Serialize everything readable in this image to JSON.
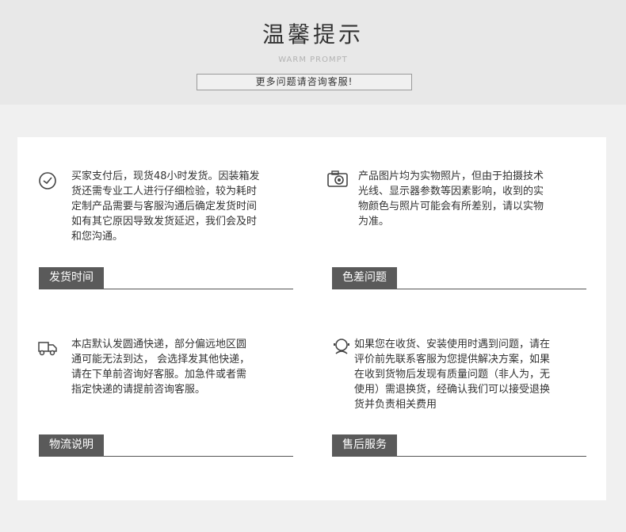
{
  "header": {
    "title": "温馨提示",
    "subtitle": "WARM PROMPT",
    "tip": "更多问题请咨询客服!"
  },
  "sections": [
    {
      "label": "发货时间",
      "icon": "clock-icon",
      "lines": [
        "买家支付后，现货48小时发货。因装箱发",
        "货还需专业工人进行仔细检验，较为耗时",
        "定制产品需要与客服沟通后确定发货时间",
        "如有其它原因导致发货延迟，我们会及时",
        "和您沟通。"
      ]
    },
    {
      "label": "色差问题",
      "icon": "camera-icon",
      "lines": [
        "产品图片均为实物照片，但由于拍摄技术",
        "光线、显示器参数等因素影响，收到的实",
        "物颜色与照片可能会有所差别，请以实物",
        "为准。"
      ]
    },
    {
      "label": "物流说明",
      "icon": "delivery-truck-icon",
      "lines": [
        "本店默认发圆通快递，部分偏远地区圆",
        "通可能无法到达，  会选择发其他快递，",
        "请在下单前咨询好客服。加急件或者需",
        "指定快递的请提前咨询客服。"
      ]
    },
    {
      "label": "售后服务",
      "icon": "customer-service-icon",
      "lines": [
        "如果您在收货、安装使用时遇到问题，请在",
        "评价前先联系客服为您提供解决方案，如果",
        "在收到货物后发现有质量问题（非人为，无",
        "使用）需退换货，经确认我们可以接受退换",
        "货并负责相关费用"
      ]
    }
  ]
}
